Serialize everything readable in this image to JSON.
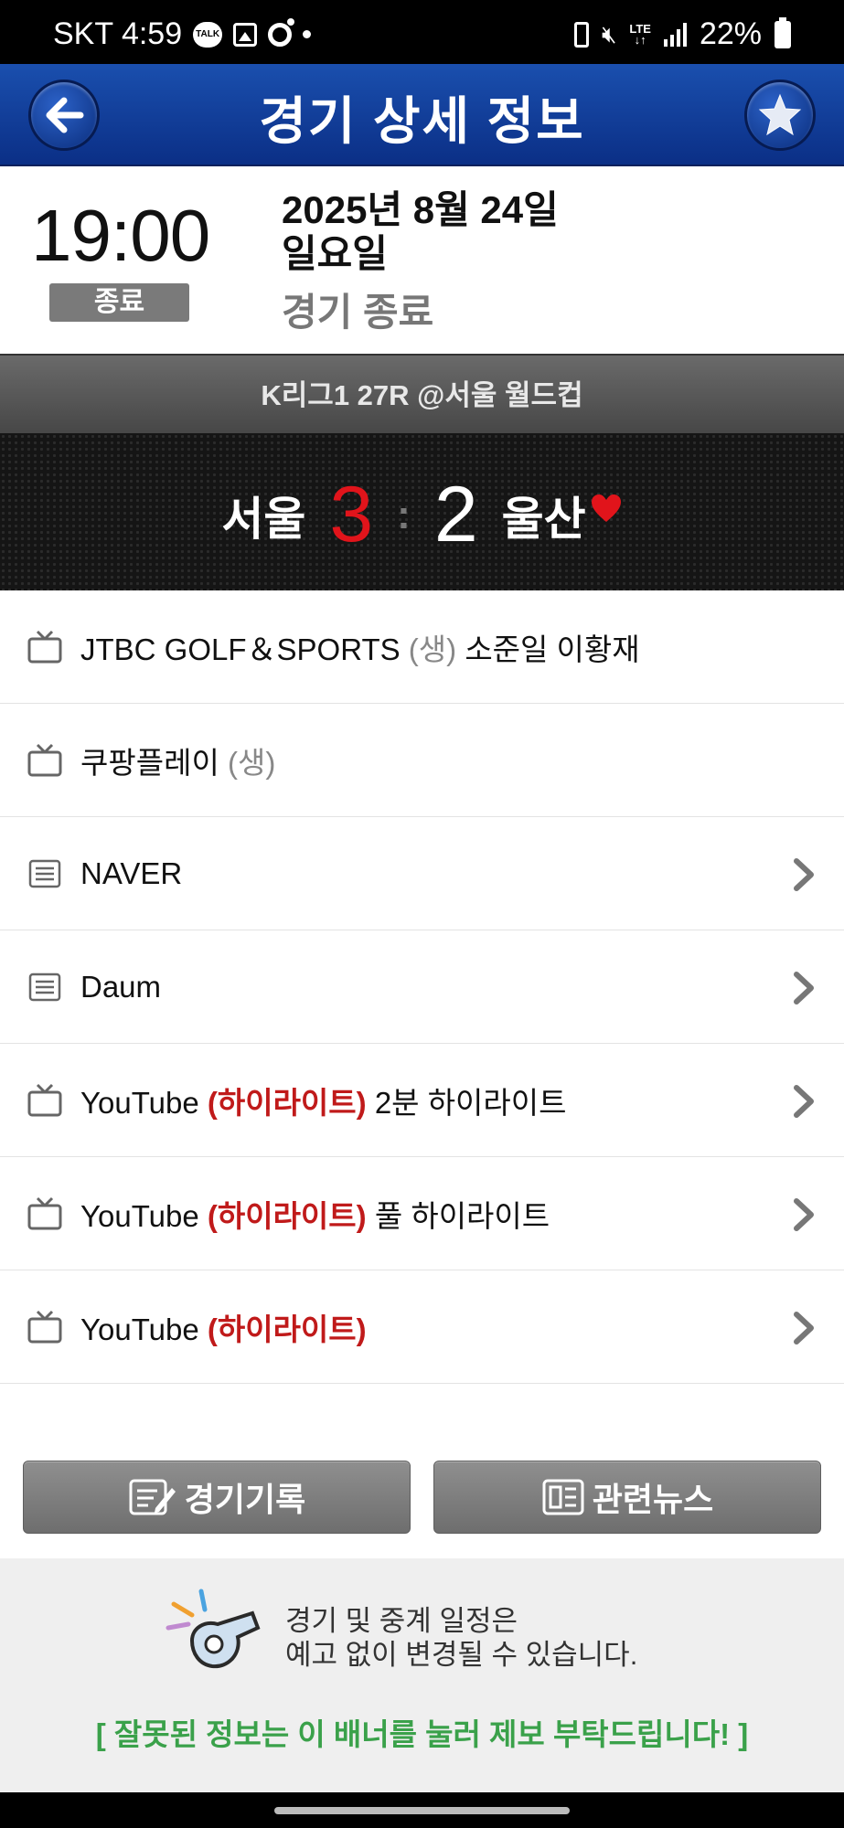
{
  "status_bar": {
    "carrier_time": "SKT 4:59",
    "talk_badge": "TALK",
    "network": "LTE",
    "battery_pct": "22%"
  },
  "title_bar": {
    "title": "경기 상세 정보",
    "back_icon": "arrow-left-icon",
    "favorite_icon": "star-icon"
  },
  "match": {
    "time": "19:00",
    "state_badge": "종료",
    "date_line1": "2025년 8월 24일",
    "date_line2": "일요일",
    "status_text": "경기 종료",
    "league_info": "K리그1 27R @서울 월드컵",
    "home_team": "서울",
    "home_score": "3",
    "separator": ":",
    "away_score": "2",
    "away_team": "울산"
  },
  "broadcasts": [
    {
      "icon": "tv-icon",
      "name": "JTBC GOLF＆SPORTS",
      "tag": "(생)",
      "extra": "소준일 이황재",
      "has_arrow": false
    },
    {
      "icon": "tv-icon",
      "name": "쿠팡플레이",
      "tag": "(생)",
      "extra": "",
      "has_arrow": false
    },
    {
      "icon": "list-icon",
      "name": "NAVER",
      "tag": "",
      "extra": "",
      "has_arrow": true
    },
    {
      "icon": "list-icon",
      "name": "Daum",
      "tag": "",
      "extra": "",
      "has_arrow": true
    },
    {
      "icon": "tv-icon",
      "name": "YouTube",
      "tag": "(하이라이트)",
      "extra": "2분 하이라이트",
      "has_arrow": true
    },
    {
      "icon": "tv-icon",
      "name": "YouTube",
      "tag": "(하이라이트)",
      "extra": "풀 하이라이트",
      "has_arrow": true
    },
    {
      "icon": "tv-icon",
      "name": "YouTube",
      "tag": "(하이라이트)",
      "extra": "",
      "has_arrow": true
    }
  ],
  "buttons": {
    "record": "경기기록",
    "news": "관련뉴스"
  },
  "banner": {
    "notice_line1": "경기 및 중계 일정은",
    "notice_line2": "예고 없이 변경될 수 있습니다.",
    "report": "[ 잘못된 정보는 이 배너를 눌러 제보 부탁드립니다! ]"
  },
  "colors": {
    "title_bar": "#0b2f86",
    "home_score": "#e1141b",
    "highlight_tag": "#c01a1a",
    "report_text": "#3aa14a"
  }
}
